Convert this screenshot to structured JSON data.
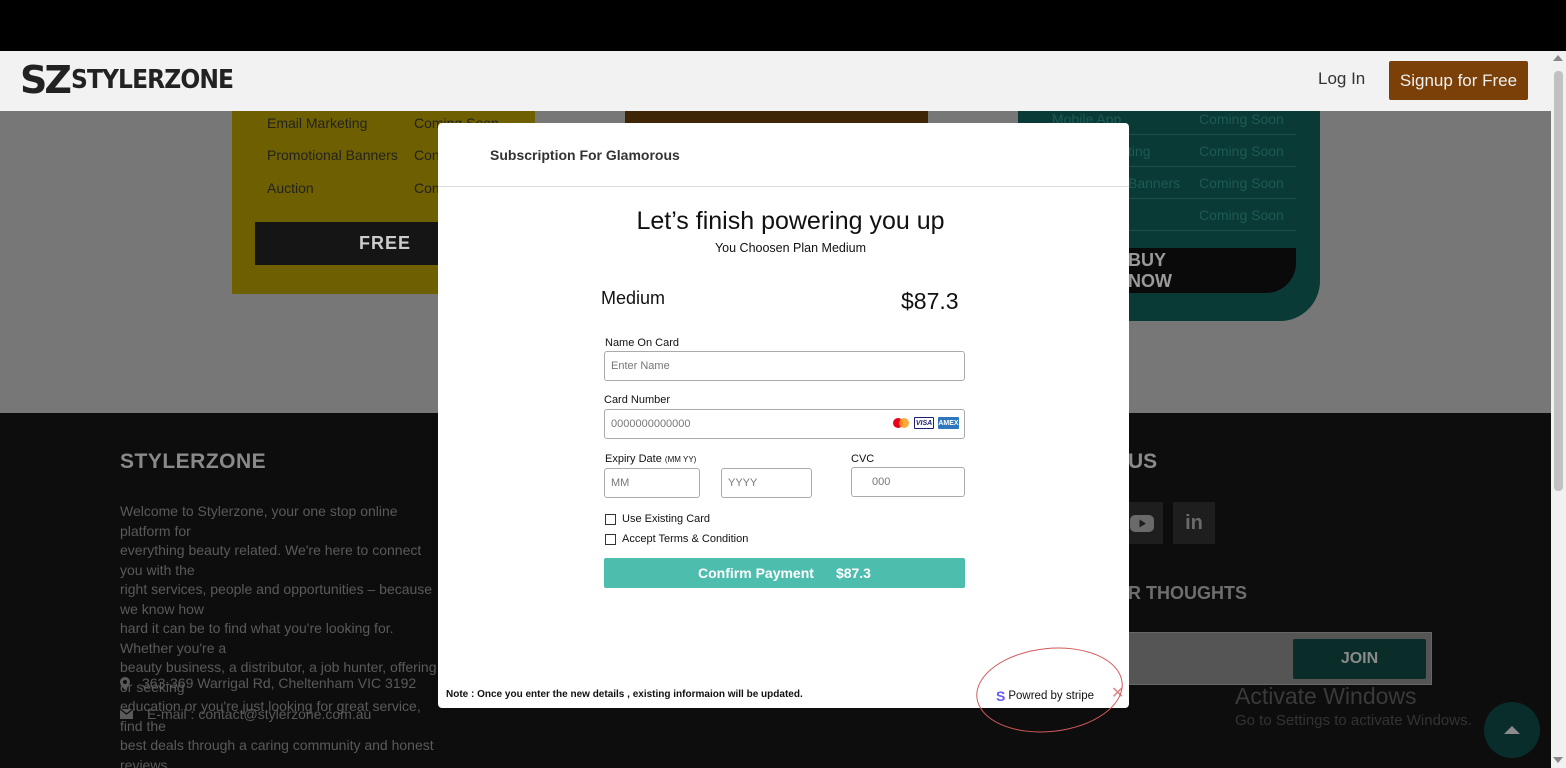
{
  "header": {
    "logo_mark": "SZ",
    "logo_text": "STYLERZONE",
    "login_label": "Log In",
    "signup_label": "Signup for Free"
  },
  "pricing": {
    "free_card": {
      "features": [
        {
          "name": "Email Marketing",
          "status": "Coming Soon"
        },
        {
          "name": "Promotional Banners",
          "status": "Con"
        },
        {
          "name": "Auction",
          "status": "Con"
        }
      ],
      "button_label": "FREE"
    },
    "pro_card": {
      "features": [
        {
          "name": "Mobile App",
          "status": "Coming Soon"
        },
        {
          "name": "ting",
          "status": "Coming Soon"
        },
        {
          "name": "Banners",
          "status": "Coming Soon"
        },
        {
          "name": "",
          "status": "Coming Soon"
        }
      ],
      "button_label": "BUY NOW"
    }
  },
  "footer": {
    "brand": "STYLERZONE",
    "description": "Welcome to Stylerzone, your one stop online platform for\neverything beauty related. We're here to connect you with the\nright services, people and opportunities – because we know how\nhard it can be to find what you're looking for. Whether you're a\nbeauty business, a distributor, a job hunter, offering or seeking\neducation or you're just looking for great service, find the\nbest deals through a caring community and honest reviews.",
    "address": "363-369 Warrigal Rd, Cheltenham VIC 3192",
    "email": "E-mail : contact@stylerzone.com.au",
    "follow_heading_partial": "US",
    "thoughts_heading_partial": "R THOUGHTS",
    "join_label": "JOIN",
    "activate_title": "Activate Windows",
    "activate_sub": "Go to Settings to activate Windows."
  },
  "modal": {
    "title": "Subscription For Glamorous",
    "headline": "Let’s finish powering you up",
    "subline": "You Choosen Plan Medium",
    "plan_name": "Medium",
    "plan_price": "$87.3",
    "name_label": "Name On Card",
    "name_placeholder": "Enter Name",
    "card_label": "Card Number",
    "card_placeholder": "0000000000000",
    "card_brands": [
      "mastercard",
      "VISA",
      "AMEX"
    ],
    "expiry_label": "Expiry Date",
    "expiry_hint": "(MM YY)",
    "month_placeholder": "MM",
    "year_placeholder": "YYYY",
    "cvc_label": "CVC",
    "cvc_placeholder": "000",
    "use_existing_label": "Use Existing Card",
    "accept_terms_label": "Accept Terms & Condition",
    "confirm_label": "Confirm Payment",
    "confirm_amount": "$87.3",
    "note": "Note : Once you enter  the new details , existing informaion will be updated.",
    "stripe_mark": "S",
    "stripe_label": "Powred by stripe",
    "close_glyph": "✕"
  }
}
